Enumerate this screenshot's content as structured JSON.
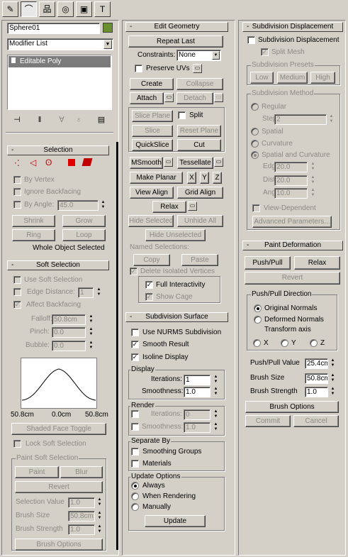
{
  "tabs": [
    {
      "name": "create-tab",
      "glyph": "✎"
    },
    {
      "name": "modify-tab",
      "glyph": "⌒"
    },
    {
      "name": "hierarchy-tab",
      "glyph": "品"
    },
    {
      "name": "motion-tab",
      "glyph": "◎"
    },
    {
      "name": "display-tab",
      "glyph": "▣"
    },
    {
      "name": "utilities-tab",
      "glyph": "T"
    }
  ],
  "object": {
    "name": "Sphere01",
    "color": "#6a8f2f",
    "modifier_list": "Modifier List",
    "stack_item": "Editable Poly"
  },
  "selection": {
    "header": "Selection",
    "by_vertex": "By Vertex",
    "ignore_backfacing": "Ignore Backfacing",
    "by_angle": "By Angle:",
    "angle_value": "45.0",
    "shrink": "Shrink",
    "grow": "Grow",
    "ring": "Ring",
    "loop": "Loop",
    "status": "Whole Object Selected"
  },
  "soft": {
    "header": "Soft Selection",
    "use_soft": "Use Soft Selection",
    "edge_distance": "Edge Distance:",
    "edge_value": "1",
    "affect_backfacing": "Affect Backfacing",
    "falloff": "Falloff:",
    "falloff_value": "50.8cm",
    "pinch": "Pinch:",
    "pinch_value": "0.0",
    "bubble": "Bubble:",
    "bubble_value": "0.0",
    "tick_left": "50.8cm",
    "tick_mid": "0.0cm",
    "tick_right": "50.8cm",
    "shaded_face": "Shaded Face Toggle",
    "lock": "Lock Soft Selection",
    "paint_group": "Paint Soft Selection",
    "paint": "Paint",
    "blur": "Blur",
    "revert": "Revert",
    "sel_value": "Selection Value",
    "sel_value_v": "1.0",
    "brush_size": "Brush Size",
    "brush_size_v": "50.8cm",
    "brush_strength": "Brush Strength",
    "brush_strength_v": "1.0",
    "brush_options": "Brush Options"
  },
  "geom": {
    "header": "Edit Geometry",
    "repeat": "Repeat Last",
    "constraints": "Constraints:",
    "constraints_value": "None",
    "preserve": "Preserve UVs",
    "create": "Create",
    "collapse": "Collapse",
    "attach": "Attach",
    "detach": "Detach",
    "slice_plane": "Slice Plane",
    "split": "Split",
    "slice": "Slice",
    "reset_plane": "Reset Plane",
    "quickslice": "QuickSlice",
    "cut": "Cut",
    "msmooth": "MSmooth",
    "tessellate": "Tessellate",
    "make_planar": "Make Planar",
    "x": "X",
    "y": "Y",
    "z": "Z",
    "view_align": "View Align",
    "grid_align": "Grid Align",
    "relax": "Relax",
    "hide_sel": "Hide Selected",
    "unhide_all": "Unhide All",
    "hide_unsel": "Hide Unselected",
    "named_sel": "Named Selections:",
    "copy": "Copy",
    "paste": "Paste",
    "delete_iso": "Delete Isolated Vertices",
    "full_interactivity": "Full Interactivity",
    "show_cage": "Show Cage"
  },
  "subsurf": {
    "header": "Subdivision Surface",
    "use_nurms": "Use NURMS Subdivision",
    "smooth_result": "Smooth Result",
    "isoline": "Isoline Display",
    "display": "Display",
    "iterations": "Iterations:",
    "iter_value": "1",
    "smoothness": "Smoothness:",
    "smooth_value": "1.0",
    "render": "Render",
    "r_iter_value": "0",
    "r_smooth_value": "1.0",
    "separate_by": "Separate By",
    "smoothing_groups": "Smoothing Groups",
    "materials": "Materials",
    "update_options": "Update Options",
    "always": "Always",
    "when_rendering": "When Rendering",
    "manually": "Manually",
    "update": "Update"
  },
  "subdisp": {
    "header": "Subdivision Displacement",
    "subdiv_disp": "Subdivision Displacement",
    "split_mesh": "Split Mesh",
    "presets": "Subdivision Presets",
    "low": "Low",
    "medium": "Medium",
    "high": "High",
    "method": "Subdivision Method",
    "regular": "Regular",
    "steps": "Steps:",
    "steps_value": "2",
    "spatial": "Spatial",
    "curvature": "Curvature",
    "spatial_curv": "Spatial and Curvature",
    "edge": "Edge:",
    "edge_value": "20.0",
    "distance": "Distance:",
    "distance_value": "20.0",
    "angle": "Angle:",
    "angle_value": "10.0",
    "view_dep": "View-Dependent",
    "advanced": "Advanced Parameters..."
  },
  "paintdef": {
    "header": "Paint Deformation",
    "push_pull": "Push/Pull",
    "relax": "Relax",
    "revert": "Revert",
    "direction": "Push/Pull Direction",
    "original": "Original Normals",
    "deformed": "Deformed Normals",
    "transform": "Transform axis",
    "x": "X",
    "y": "Y",
    "z": "Z",
    "pp_value": "Push/Pull Value",
    "pp_value_v": "25.4cm",
    "brush_size": "Brush Size",
    "brush_size_v": "50.8cm",
    "brush_strength": "Brush Strength",
    "brush_strength_v": "1.0",
    "brush_options": "Brush Options",
    "commit": "Commit",
    "cancel": "Cancel"
  }
}
